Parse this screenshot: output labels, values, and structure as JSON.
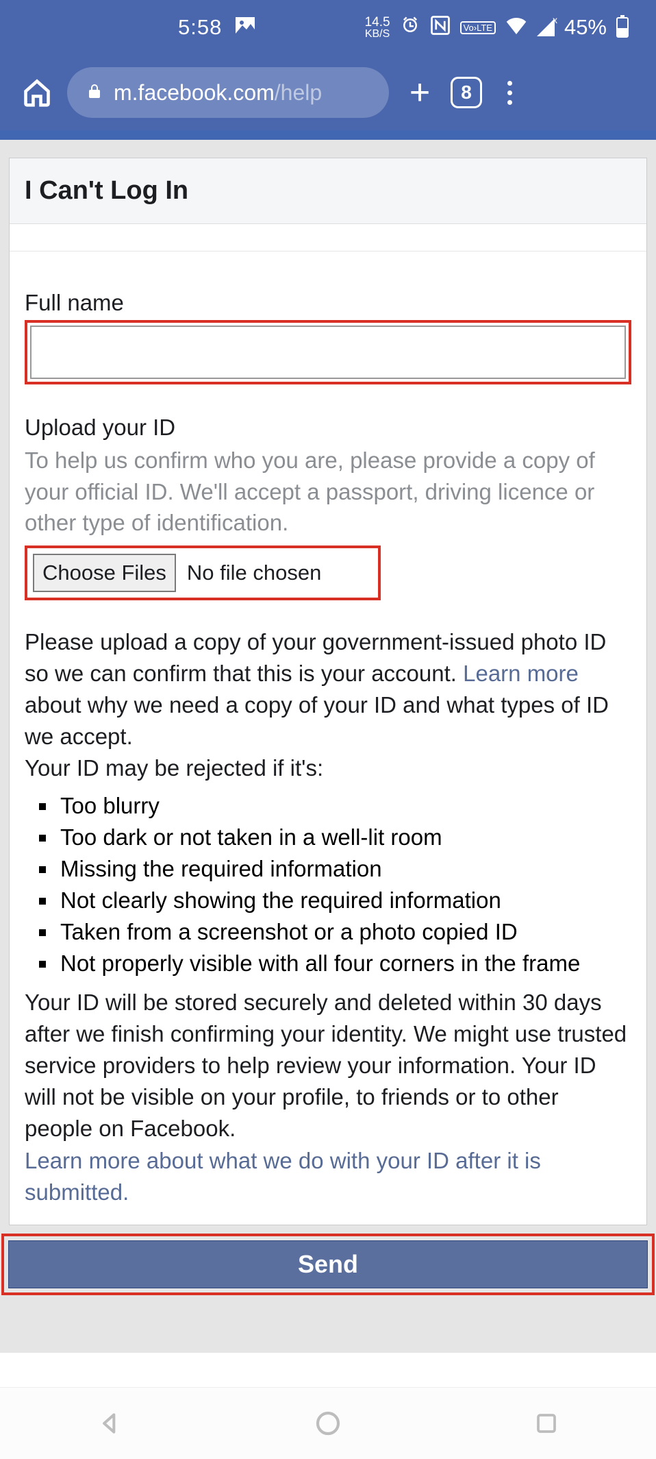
{
  "status": {
    "time": "5:58",
    "kbs_value": "14.5",
    "kbs_label": "KB/S",
    "lte": "Vo›LTE",
    "signal_x": "x",
    "battery_pct": "45%"
  },
  "browser": {
    "url_host": "m.facebook.com",
    "url_path": "/help",
    "tabs": "8"
  },
  "header": {
    "title": "I Can't Log In"
  },
  "form": {
    "full_name_label": "Full name",
    "full_name_value": "",
    "upload_label": "Upload your ID",
    "upload_help": "To help us confirm who you are, please provide a copy of your official ID. We'll accept a passport, driving licence or other type of identification.",
    "choose_files": "Choose Files",
    "no_file": "No file chosen",
    "instructions_pre": "Please upload a copy of your government-issued photo ID so we can confirm that this is your account. ",
    "learn_more_1": "Learn more",
    "instructions_post": " about why we need a copy of your ID and what types of ID we accept.",
    "reject_intro": "Your ID may be rejected if it's:",
    "reject_reasons": [
      "Too blurry",
      "Too dark or not taken in a well-lit room",
      "Missing the required information",
      "Not clearly showing the required information",
      "Taken from a screenshot or a photo copied ID",
      "Not properly visible with all four corners in the frame"
    ],
    "storage_text": "Your ID will be stored securely and deleted within 30 days after we finish confirming your identity. We might use trusted service providers to help review your information. Your ID will not be visible on your profile, to friends or to other people on Facebook.",
    "learn_more_2": "Learn more about what we do with your ID after it is submitted.",
    "send": "Send"
  }
}
